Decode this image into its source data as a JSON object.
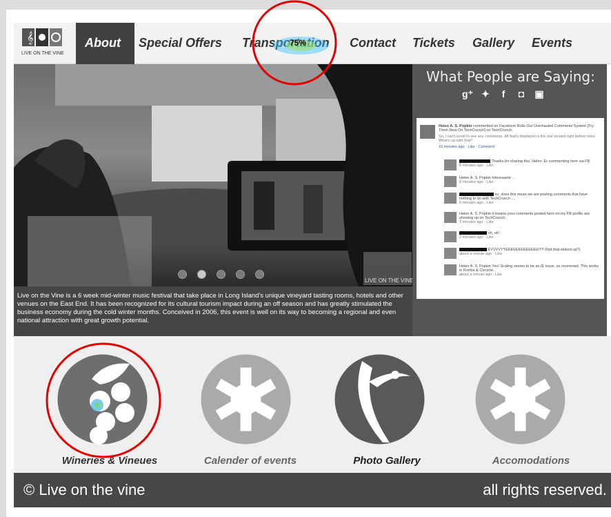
{
  "logo": {
    "text": "LIVE ON THE VINE"
  },
  "nav": {
    "items": [
      "About",
      "Special Offers",
      "Transportation",
      "Contact",
      "Tickets",
      "Gallery",
      "Events"
    ]
  },
  "heatmap": {
    "overlay_label": "75%"
  },
  "hero": {
    "badge_text": "LIVE ON THE VINE",
    "caption": "Live on the Vine is a 6 week mid-winter music festival that take place in Long Island's unique vineyard tasting rooms, hotels and other venues on the East End. It has been recognized for its cultural tourism impact during an off season and has greatly stimulated the business economy during the cold winter months. Conceived in 2006, this event is well on its way to becoming a regional and even national attraction with great growth potential."
  },
  "sidebar": {
    "title": "What People are Saying:",
    "social_icons": [
      "google-plus",
      "twitter",
      "facebook",
      "instagram",
      "youtube"
    ],
    "post": {
      "author": "Helen A. S. Popkin",
      "text": "commented on Facebook Rolls Out Overhauled Comments System [Try Them Now On TechCrunch] on TechCrunch.",
      "quote": "So, I can't scroll to see any comments. All that's displayed is the one posted right before mine. What's up with that?",
      "meta": "10 minutes ago · Like · Comment"
    },
    "replies": [
      {
        "text": "Thanks for sharing this, Helen. Er commenting here via FB.",
        "meta": "8 minutes ago · Like"
      },
      {
        "text": "Helen A. S. Popkin Interesante ...",
        "meta": "8 minutes ago · Like"
      },
      {
        "text": "so, does this mean we are posting comments that have nothing to do with TechCrunch ....",
        "meta": "5 minutes ago · Like"
      },
      {
        "text": "Helen A. S. Popkin it means your comments posted here on my FB profile are showing up on TechCrunch.",
        "meta": "3 minutes ago · Like"
      },
      {
        "text": "oh, ok!",
        "meta": "2 minutes ago · Like"
      },
      {
        "text": "EVVVVYYEEEEEEEEEEEEE!!!!! (Not that stoked up?)",
        "meta": "about a minute ago · Like"
      },
      {
        "text": "Helen A. S. Popkin Yes! Scaling seems to be an IE issue, as reverened. This works in Firefox & Chrome.",
        "meta": "about a minute ago · Like"
      }
    ]
  },
  "tiles": [
    {
      "label": "Wineries & Vineues"
    },
    {
      "label": "Calender of events"
    },
    {
      "label": "Photo Gallery"
    },
    {
      "label": "Accomodations"
    }
  ],
  "footer": {
    "copyright": "© Live on the vine",
    "rights": "all rights reserved."
  },
  "colors": {
    "nav_active": "#404040",
    "footer": "#474747",
    "annotation": "#e00000"
  }
}
